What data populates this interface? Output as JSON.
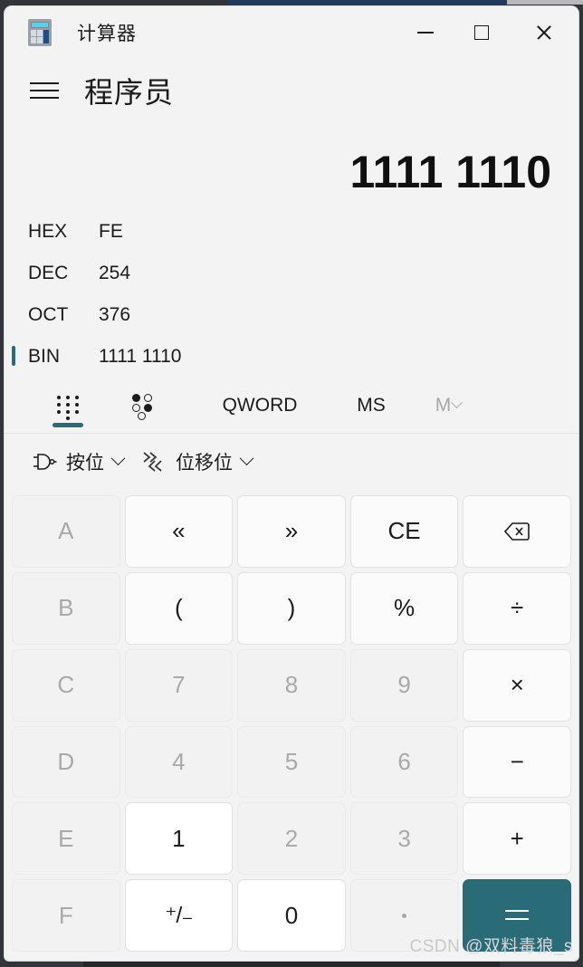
{
  "window": {
    "app_icon": "calculator-icon",
    "title": "计算器",
    "controls": {
      "minimize": "minimize-icon",
      "maximize": "maximize-icon",
      "close": "close-icon"
    }
  },
  "mode_header": {
    "menu_icon": "hamburger-menu-icon",
    "title": "程序员"
  },
  "display": {
    "value": "1111 1110",
    "radix": [
      {
        "label": "HEX",
        "value": "FE",
        "active": false
      },
      {
        "label": "DEC",
        "value": "254",
        "active": false
      },
      {
        "label": "OCT",
        "value": "376",
        "active": false
      },
      {
        "label": "BIN",
        "value": "1111 1110",
        "active": true
      }
    ]
  },
  "toolbar": {
    "keypad_icon": "keypad-icon",
    "bit_toggle_icon": "bit-toggle-icon",
    "word_size": "QWORD",
    "memory_store": "MS",
    "memory_label": "M",
    "memory_chevron": "chevron-down-icon"
  },
  "functions": {
    "bitwise": {
      "icon": "logic-gate-icon",
      "label": "按位",
      "chevron": "chevron-down-icon"
    },
    "bitshift": {
      "icon": "bit-shift-icon",
      "label": "位移位",
      "chevron": "chevron-down-icon"
    }
  },
  "keypad": {
    "rows": [
      [
        {
          "label": "A",
          "style": "disabled",
          "name": "key-a"
        },
        {
          "label": "«",
          "style": "light",
          "name": "key-shift-left"
        },
        {
          "label": "»",
          "style": "light",
          "name": "key-shift-right"
        },
        {
          "label": "CE",
          "style": "light",
          "name": "key-clear-entry"
        },
        {
          "label": "",
          "style": "light",
          "name": "key-backspace",
          "icon": "backspace-icon"
        }
      ],
      [
        {
          "label": "B",
          "style": "disabled",
          "name": "key-b"
        },
        {
          "label": "(",
          "style": "light",
          "name": "key-open-paren"
        },
        {
          "label": ")",
          "style": "light",
          "name": "key-close-paren"
        },
        {
          "label": "%",
          "style": "light",
          "name": "key-percent"
        },
        {
          "label": "÷",
          "style": "light",
          "name": "key-divide"
        }
      ],
      [
        {
          "label": "C",
          "style": "disabled",
          "name": "key-c"
        },
        {
          "label": "7",
          "style": "disabled",
          "name": "key-7"
        },
        {
          "label": "8",
          "style": "disabled",
          "name": "key-8"
        },
        {
          "label": "9",
          "style": "disabled",
          "name": "key-9"
        },
        {
          "label": "×",
          "style": "light",
          "name": "key-multiply"
        }
      ],
      [
        {
          "label": "D",
          "style": "disabled",
          "name": "key-d"
        },
        {
          "label": "4",
          "style": "disabled",
          "name": "key-4"
        },
        {
          "label": "5",
          "style": "disabled",
          "name": "key-5"
        },
        {
          "label": "6",
          "style": "disabled",
          "name": "key-6"
        },
        {
          "label": "−",
          "style": "light",
          "name": "key-subtract"
        }
      ],
      [
        {
          "label": "E",
          "style": "disabled",
          "name": "key-e"
        },
        {
          "label": "1",
          "style": "white",
          "name": "key-1"
        },
        {
          "label": "2",
          "style": "disabled",
          "name": "key-2"
        },
        {
          "label": "3",
          "style": "disabled",
          "name": "key-3"
        },
        {
          "label": "+",
          "style": "light",
          "name": "key-add"
        }
      ],
      [
        {
          "label": "F",
          "style": "disabled",
          "name": "key-f"
        },
        {
          "label": "⁺/₋",
          "style": "white",
          "name": "key-plus-minus"
        },
        {
          "label": "0",
          "style": "white",
          "name": "key-0"
        },
        {
          "label": "",
          "style": "disabled",
          "name": "key-decimal",
          "icon": "dot-icon"
        },
        {
          "label": "",
          "style": "accent",
          "name": "key-equals",
          "icon": "equals-icon"
        }
      ]
    ]
  },
  "watermark": {
    "prefix": "CSDN",
    "handle": "@双料毒狼_s"
  },
  "colors": {
    "accent": "#2a6b78",
    "window_bg": "#f3f3f3",
    "key_bg": "#f2f2f2"
  }
}
